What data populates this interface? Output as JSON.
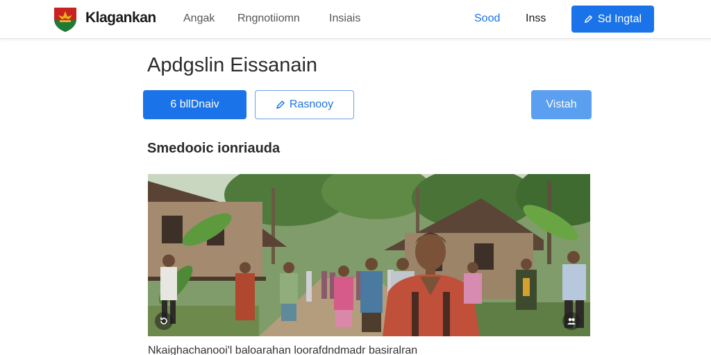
{
  "header": {
    "brand": "Klagankan",
    "nav": [
      "Angak",
      "Rngnotiiomn",
      "Insiais"
    ],
    "accent_link": "Sood",
    "dark_link": "Inss",
    "cta_label": "Sd Ingtal"
  },
  "main": {
    "title": "Apdgslin Eissanain",
    "actions": {
      "primary": "6 bllDnaiv",
      "secondary": "Rasnooy",
      "tertiary": "Vistah"
    },
    "section_heading": "Smedooic ionriauda",
    "caption": "Nkaighachanooi'l baloarahan loorafdndmadr basiralran"
  },
  "colors": {
    "accent": "#1a73e8",
    "accent_light": "#5a9ff0",
    "logo_red": "#c8231e",
    "logo_green": "#1f7a3a",
    "logo_gold": "#e8b21f"
  },
  "icons": {
    "logo": "shield-emblem-icon",
    "cta": "pencil-icon",
    "secondary": "pencil-icon",
    "photo_left": "replay-icon",
    "photo_right": "people-icon"
  }
}
